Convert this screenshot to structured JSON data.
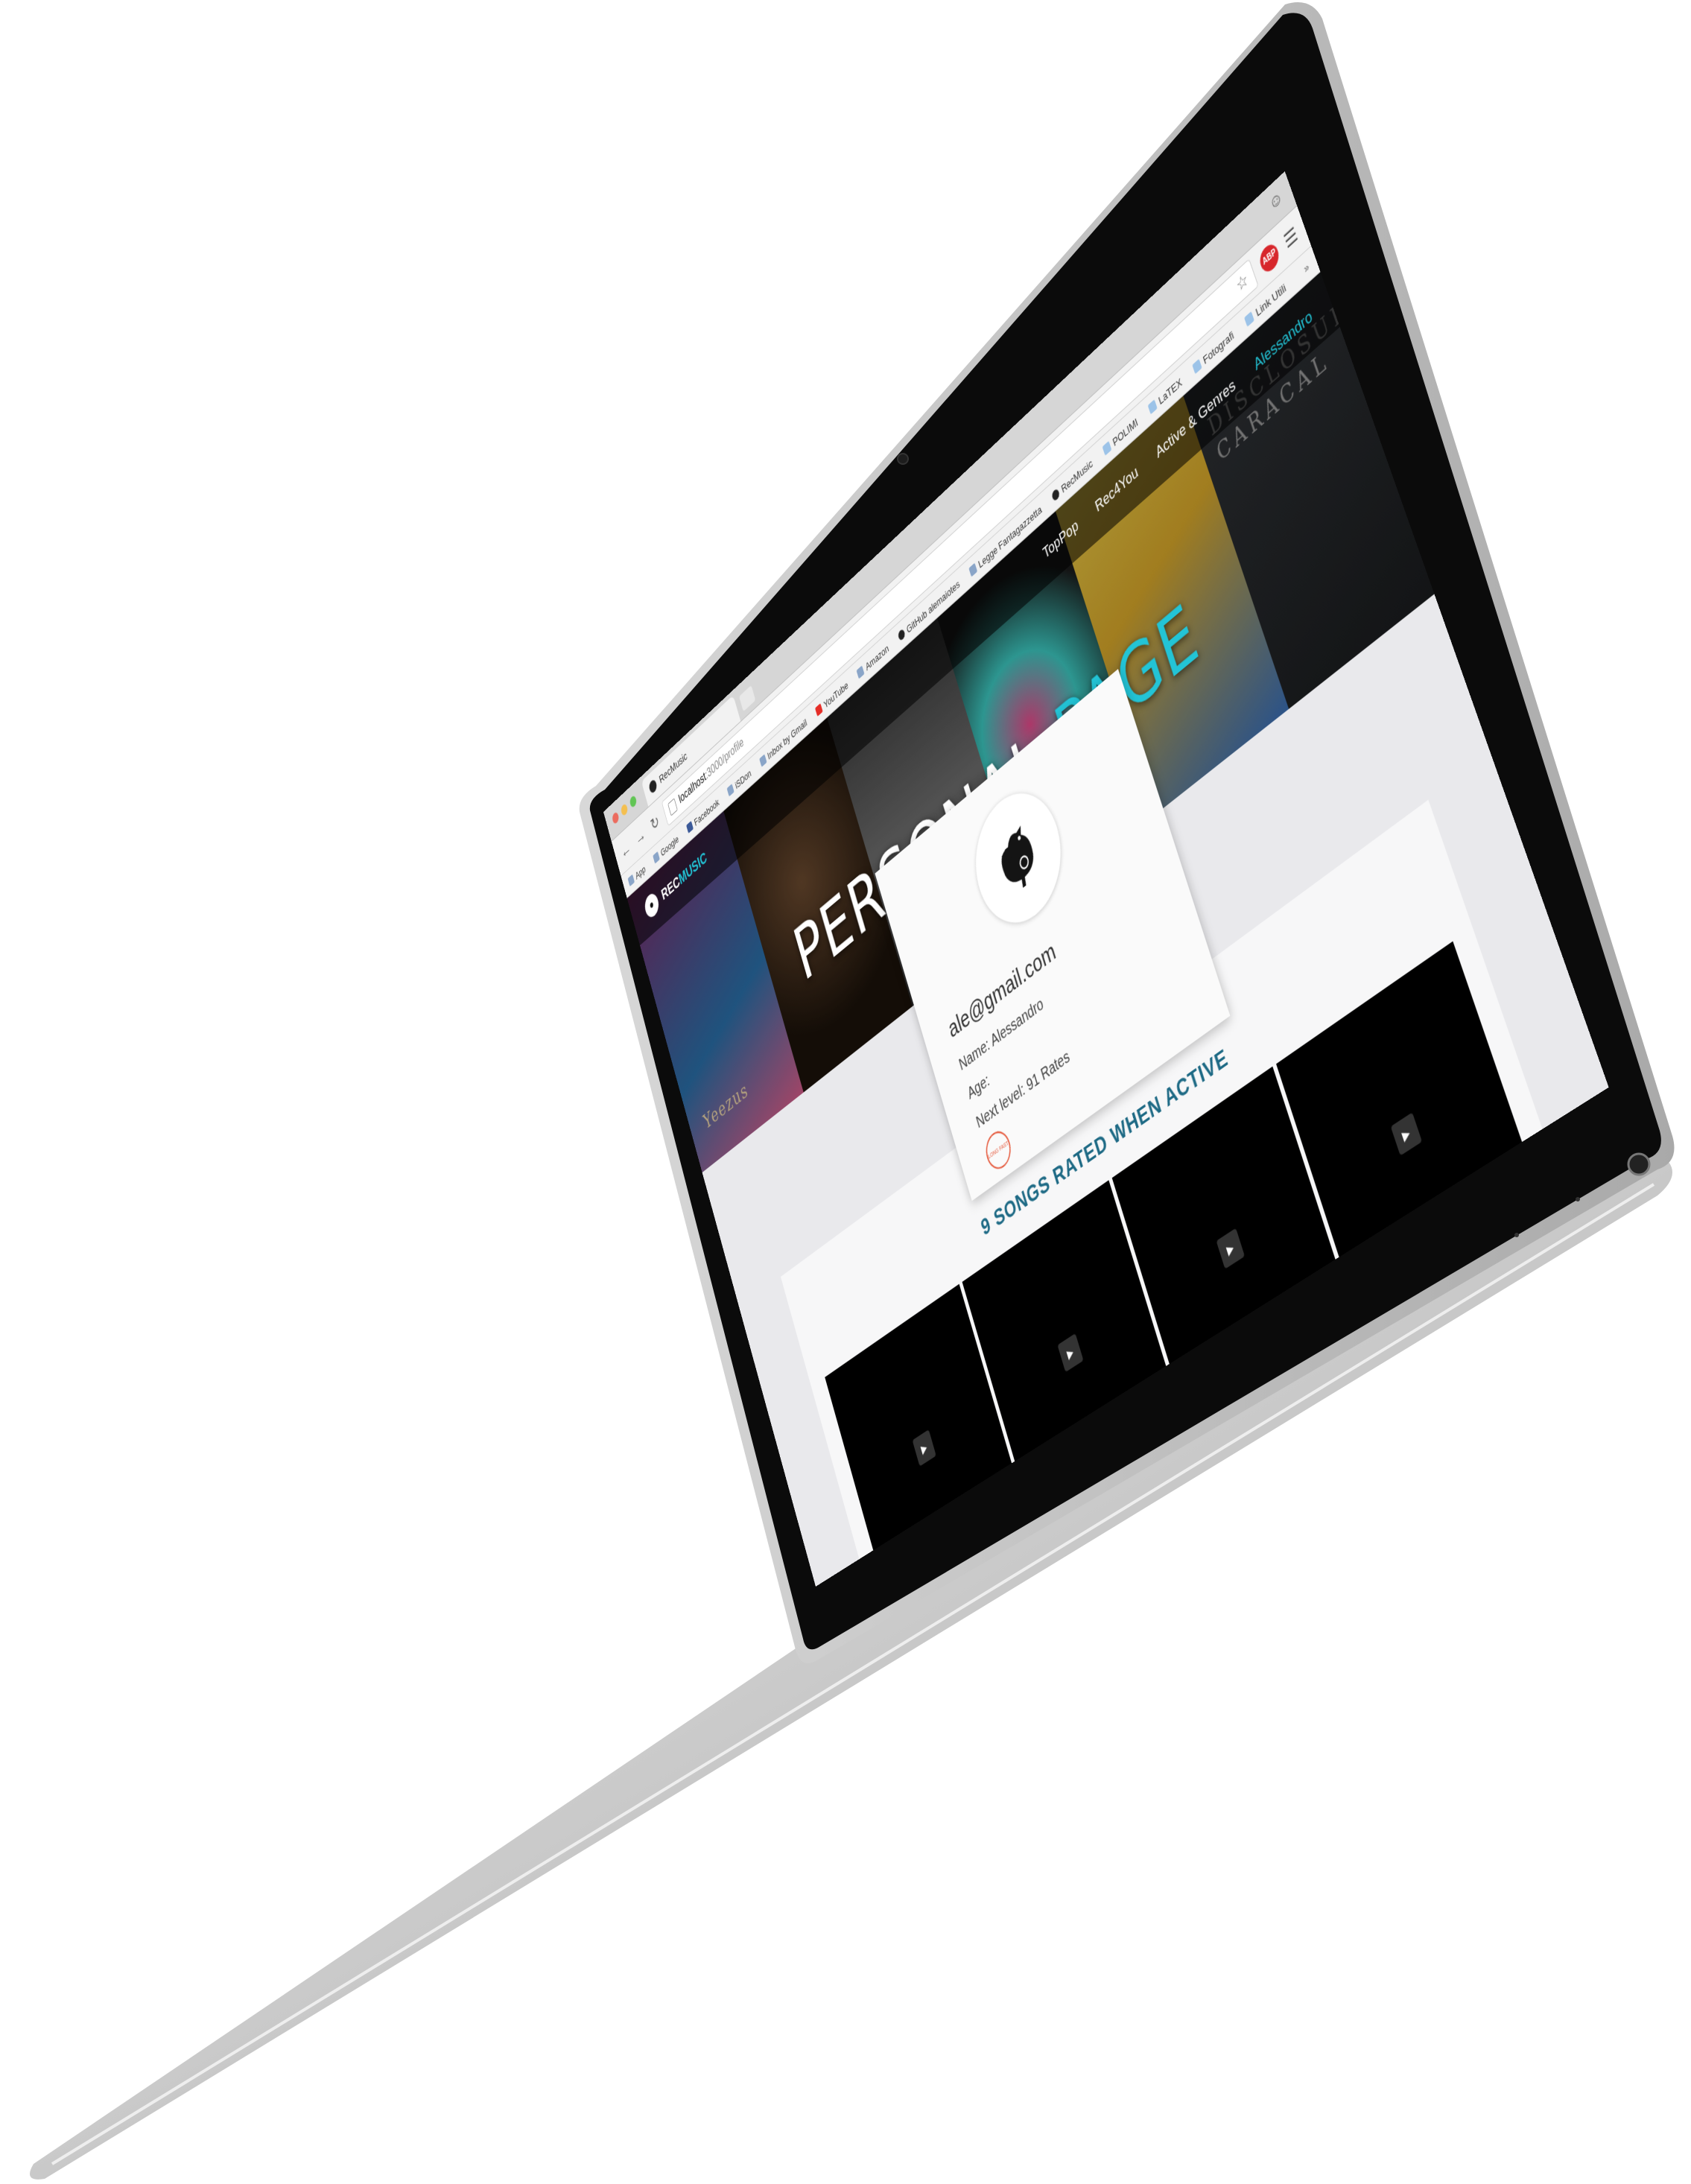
{
  "browser": {
    "tab_title": "RecMusic",
    "url_host": "localhost",
    "url_path": ":3000/profile",
    "adblock_label": "ABP",
    "bookmarks": [
      "App",
      "Google",
      "Facebook",
      "iSDon",
      "Inbox by Gmail",
      "YouTube",
      "Amazon",
      "GitHub alemaiotes",
      "Legge Fantagazzetta",
      "RecMusic",
      "POLIMI",
      "LaTEX",
      "Fotografi",
      "Link Utili"
    ]
  },
  "site": {
    "logo_prefix": "REC",
    "logo_accent": "MUSIC",
    "nav": [
      "TopPop",
      "Rec4You",
      "Active & Genres",
      "Alessandro"
    ],
    "hero_title": "PERSONAL",
    "hero_title_accent": "PAGE",
    "cover_labels": [
      "Yeezus",
      "DISCLOSURE CARACAL"
    ]
  },
  "profile": {
    "email": "ale@gmail.com",
    "name_line": "Name: Alessandro",
    "age_line": "Age:",
    "level_line": "Next level: 91 Rates",
    "badge_label": "LONG FAST"
  },
  "rated": {
    "title": "9 SONGS RATED WHEN ACTIVE"
  },
  "colors": {
    "accent": "#23c4d6",
    "rated_title": "#1e6a85",
    "badge": "#e5583b"
  }
}
